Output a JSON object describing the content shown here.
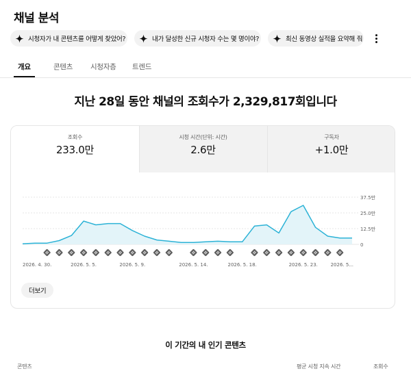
{
  "page": {
    "title": "채널 분석"
  },
  "prompts": [
    {
      "label": "시청자가 내 콘텐츠를 어떻게 찾았어?"
    },
    {
      "label": "내가 달성한 신규 시청자 수는 몇 명이야?"
    },
    {
      "label": "최신 동영상 실적을 요약해 줘"
    }
  ],
  "tabs": [
    {
      "label": "개요"
    },
    {
      "label": "콘텐츠"
    },
    {
      "label": "시청자층"
    },
    {
      "label": "트렌드"
    }
  ],
  "headline": "지난 28일 동안 채널의 조회수가 2,329,817회입니다",
  "metrics": [
    {
      "label": "조회수",
      "value": "233.0만"
    },
    {
      "label": "시청 시간(단위: 시간)",
      "value": "2.6만"
    },
    {
      "label": "구독자",
      "value": "+1.0만"
    }
  ],
  "chart_data": {
    "type": "area",
    "series_name": "조회수",
    "unit": "만",
    "x": [
      1,
      2,
      3,
      4,
      5,
      6,
      7,
      8,
      9,
      10,
      11,
      12,
      13,
      14,
      15,
      16,
      17,
      18,
      19,
      20,
      21,
      22,
      23,
      24,
      25,
      26,
      27,
      28
    ],
    "values": [
      0.5,
      1.0,
      1.0,
      3.0,
      7.0,
      18.5,
      15.5,
      16.5,
      16.5,
      11.0,
      6.5,
      3.5,
      2.5,
      1.5,
      1.5,
      2.0,
      2.5,
      2.0,
      2.0,
      14.5,
      15.5,
      9.0,
      26.0,
      31.0,
      13.5,
      6.5,
      5.0,
      5.0
    ],
    "y_ticks": [
      "0",
      "12.5만",
      "25.0만",
      "37.5만"
    ],
    "y_tick_values": [
      0,
      12.5,
      25.0,
      37.5
    ],
    "ylim": [
      0,
      37.5
    ],
    "x_tick_labels": [
      "2026. 4. 30.",
      "2026. 5. 5.",
      "2026. 5. 9.",
      "2026. 5. 14.",
      "2026. 5. 18.",
      "2026. 5. 23.",
      "2026. 5..."
    ],
    "x_tick_days": [
      1,
      6,
      10,
      15,
      19,
      24,
      28
    ],
    "marker_days": [
      3,
      4,
      5,
      6,
      7,
      8,
      9,
      10,
      11,
      12,
      13,
      15,
      16,
      17,
      18,
      20,
      21,
      22,
      23,
      24,
      25,
      26,
      27
    ],
    "marker_icon": "upload-icon",
    "grid": true,
    "colors": {
      "line": "#2bb2d6",
      "fill": "#e3f4f9",
      "grid": "#e5e5e5"
    }
  },
  "more_link": {
    "label": "더보기"
  },
  "top_content": {
    "title": "이 기간의 내 인기 콘텐츠",
    "columns": [
      "콘텐츠",
      "평균 시청 지속 시간",
      "조회수"
    ]
  },
  "icons": {
    "prompt": "sparkle-icon",
    "menu": "more-vert-icon"
  }
}
